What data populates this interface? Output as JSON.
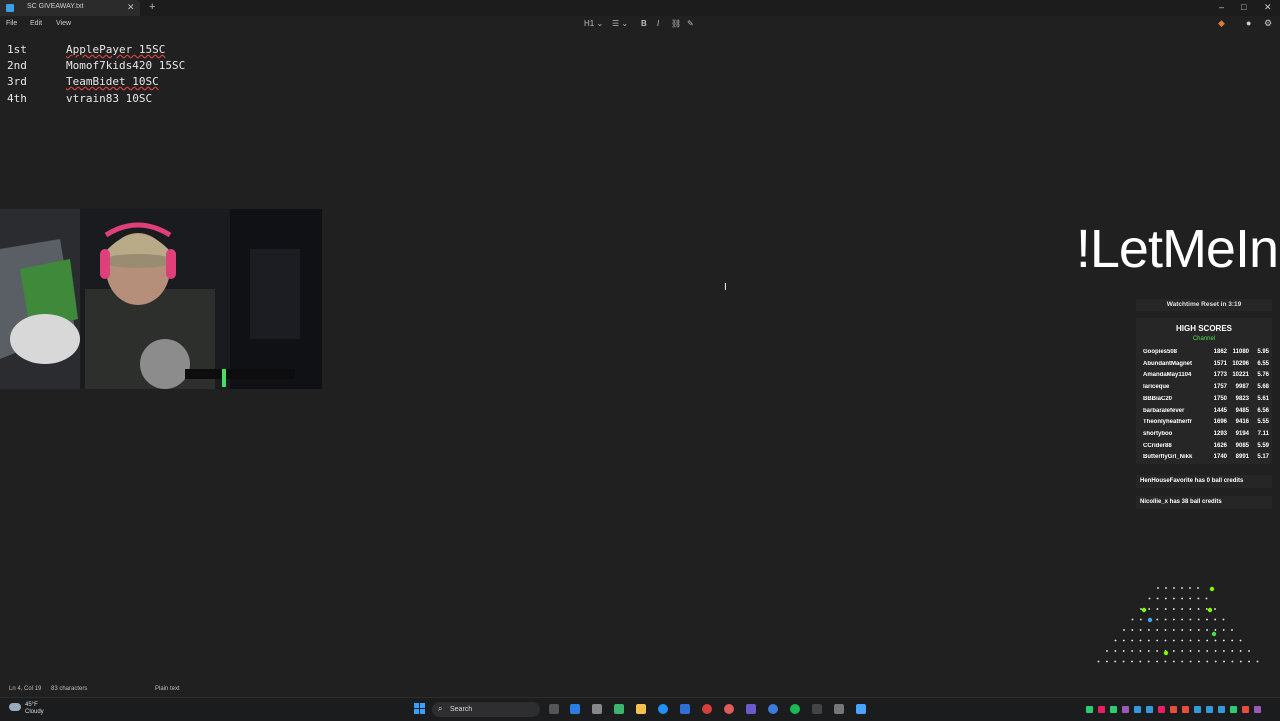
{
  "window": {
    "tab_title": "SC GIVEAWAY.txt",
    "tab_close": "✕",
    "new_tab": "+",
    "minimize": "–",
    "maximize": "□",
    "close": "✕"
  },
  "menu": {
    "file": "File",
    "edit": "Edit",
    "view": "View"
  },
  "toolbar": {
    "heading": "H1 ⌄",
    "list": "☰ ⌄",
    "bold": "B",
    "italic": "I",
    "link": "⛓",
    "clear_format": "✎"
  },
  "document": {
    "lines": [
      {
        "place": "1st",
        "entry": "ApplePayer 15SC"
      },
      {
        "place": "2nd",
        "entry": "Momof7kids420 15SC"
      },
      {
        "place": "3rd",
        "entry": "TeamBidet 10SC"
      },
      {
        "place": "4th",
        "entry": "vtrain83 10SC"
      }
    ]
  },
  "overlay": {
    "command": "!LetMeIn",
    "watchtime": "Watchtime Reset in 3:19",
    "high_scores_title": "HIGH SCORES",
    "high_scores_sub": "Channel",
    "scores": [
      {
        "name": "Goopies508",
        "a": "1862",
        "b": "11080",
        "c": "5.95"
      },
      {
        "name": "AbundantMagnet",
        "a": "1571",
        "b": "10296",
        "c": "6.55"
      },
      {
        "name": "AmandaMay1104",
        "a": "1773",
        "b": "10221",
        "c": "5.76"
      },
      {
        "name": "lariceque",
        "a": "1757",
        "b": "9987",
        "c": "5.68"
      },
      {
        "name": "BBBiaC20",
        "a": "1750",
        "b": "9823",
        "c": "5.61"
      },
      {
        "name": "barbaralefever",
        "a": "1445",
        "b": "9485",
        "c": "6.56"
      },
      {
        "name": "Theonlyheatherfr",
        "a": "1696",
        "b": "9416",
        "c": "5.55"
      },
      {
        "name": "shortyboo",
        "a": "1293",
        "b": "9194",
        "c": "7.11"
      },
      {
        "name": "CCrider88",
        "a": "1626",
        "b": "9085",
        "c": "5.59"
      },
      {
        "name": "ButterflyGrl_Nikk",
        "a": "1740",
        "b": "8991",
        "c": "5.17"
      }
    ],
    "credits": [
      "HenHouseFavorite has 0 ball credits",
      "Nicollie_x has 38 ball credits"
    ]
  },
  "status": {
    "position": "Ln 4, Col 19",
    "characters": "83 characters",
    "format": "Plain text"
  },
  "taskbar": {
    "weather_temp": "45°F",
    "weather_desc": "Cloudy",
    "search": "Search"
  },
  "colors": {
    "background": "#202020",
    "scores_green": "#4ce04c",
    "windows_blue": "#3aa0ff"
  }
}
